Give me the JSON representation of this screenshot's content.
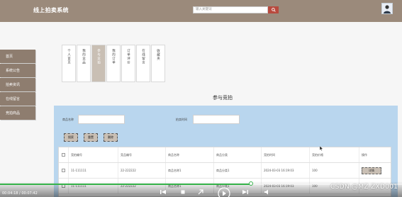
{
  "header": {
    "site_title": "线上拍卖系统",
    "search_placeholder": "输入关键词"
  },
  "sidebar": {
    "items": [
      {
        "label": "首页"
      },
      {
        "label": "系统公告"
      },
      {
        "label": "拍卖资讯"
      },
      {
        "label": "在线留言"
      },
      {
        "label": "竞拍商品"
      }
    ]
  },
  "tabs": [
    {
      "label": "个人首页",
      "active": false
    },
    {
      "label": "我的竞品",
      "active": false
    },
    {
      "label": "参与竞拍",
      "active": true
    },
    {
      "label": "我的订单",
      "active": false
    },
    {
      "label": "订单评价",
      "active": false
    },
    {
      "label": "在线留言",
      "active": false
    },
    {
      "label": "收藏夹",
      "active": false
    }
  ],
  "section_title": "参与竞拍",
  "filters": {
    "product_name_label": "商品名称",
    "bid_time_label": "拍卖时间"
  },
  "buttons": {
    "search": "搜索",
    "reset": "重置",
    "delete": "删除"
  },
  "table": {
    "columns": [
      "竞拍编号",
      "竞品编号",
      "商品名称",
      "商品分类",
      "竞拍时间",
      "竞拍价格",
      "操作"
    ],
    "rows": [
      {
        "bid_no": "11-111111",
        "item_no": "22-222222",
        "name": "商品名称1",
        "category": "商品分类1",
        "time": "2024-03-03 16:19:03",
        "price": "100",
        "action": "详情"
      },
      {
        "bid_no": "11-111111",
        "item_no": "22-222222",
        "name": "商品名称1",
        "category": "商品分类1",
        "time": "2024-03-03 16:19:03",
        "price": "100",
        "action": ""
      }
    ]
  },
  "video": {
    "time_display": "00:04:18 / 00:07:42",
    "progress_fraction": 0.624
  },
  "watermark": "CSDN @MZ ZXD001",
  "colors": {
    "header_bg": "#9b8a7b",
    "sidebar_bg": "#8e7d6f",
    "panel_bg": "#b9d6ee",
    "accent_button": "#b84a3e",
    "progress": "#36b34a"
  }
}
